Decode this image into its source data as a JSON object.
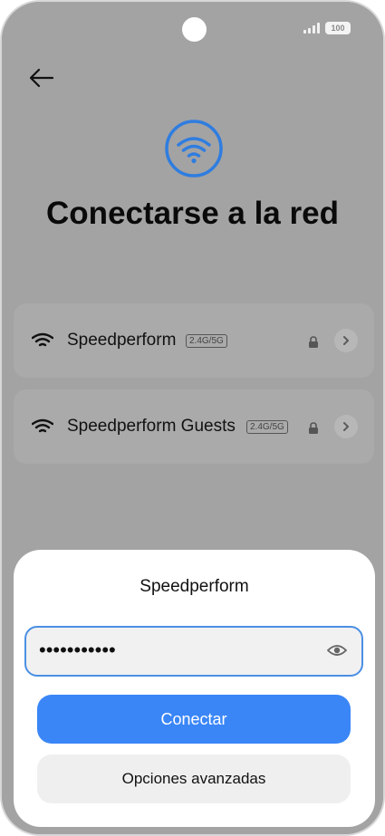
{
  "status_bar": {
    "battery_label": "100",
    "signal-icon": "cell-signal-icon"
  },
  "header": {
    "back_icon": "arrow-left-icon",
    "hero_icon": "wifi-icon",
    "title": "Conectarse a la red"
  },
  "networks": [
    {
      "name": "Speedperform",
      "band": "2.4G/5G",
      "secured": true
    },
    {
      "name": "Speedperform Guests",
      "band": "2.4G/5G",
      "secured": true
    }
  ],
  "dialog": {
    "network_name": "Speedperform",
    "password_masked": "•••••••••••",
    "eye_icon": "eye-icon",
    "connect_label": "Conectar",
    "advanced_label": "Opciones avanzadas"
  },
  "colors": {
    "accent": "#3a86f7",
    "hero_ring": "#2f7de0",
    "overlay": "#a3a3a3"
  }
}
